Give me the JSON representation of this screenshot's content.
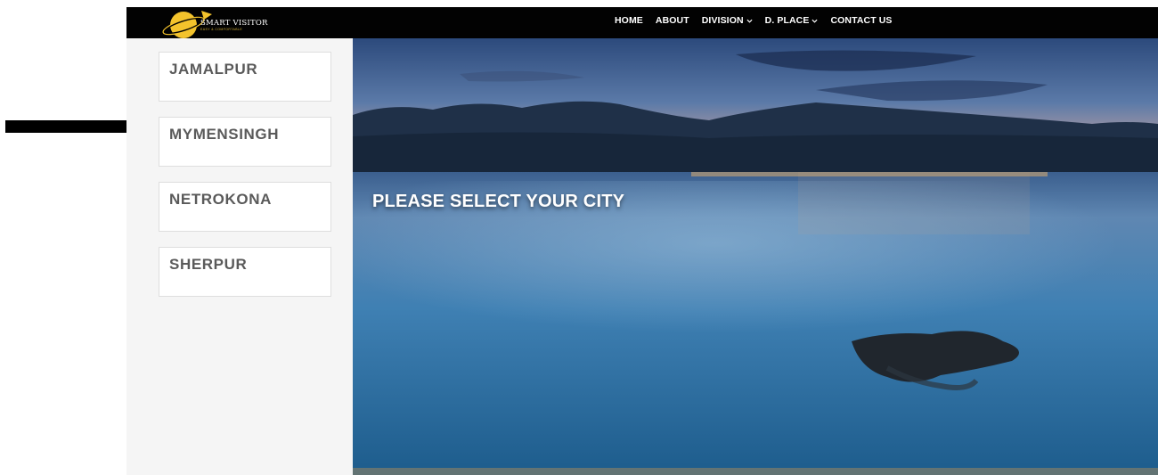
{
  "brand": {
    "name": "SMART VISITOR",
    "tagline": "EASY & COMFORTABLE"
  },
  "nav": [
    {
      "label": "HOME",
      "dropdown": false
    },
    {
      "label": "ABOUT",
      "dropdown": false
    },
    {
      "label": "DIVISION",
      "dropdown": true
    },
    {
      "label": "D. PLACE",
      "dropdown": true
    },
    {
      "label": "CONTACT US",
      "dropdown": false
    }
  ],
  "cities": [
    "JAMALPUR",
    "MYMENSINGH",
    "NETROKONA",
    "SHERPUR"
  ],
  "hero": {
    "title": "PLEASE SELECT YOUR CITY"
  },
  "colors": {
    "topbar": "#020202",
    "sidebar_bg": "#f5f5f5",
    "card_text": "#5a5a5a",
    "logo_planet": "#f3c32c"
  },
  "icons": {
    "annotation": "arrow-right-icon",
    "nav_dropdown": "chevron-down-icon"
  }
}
